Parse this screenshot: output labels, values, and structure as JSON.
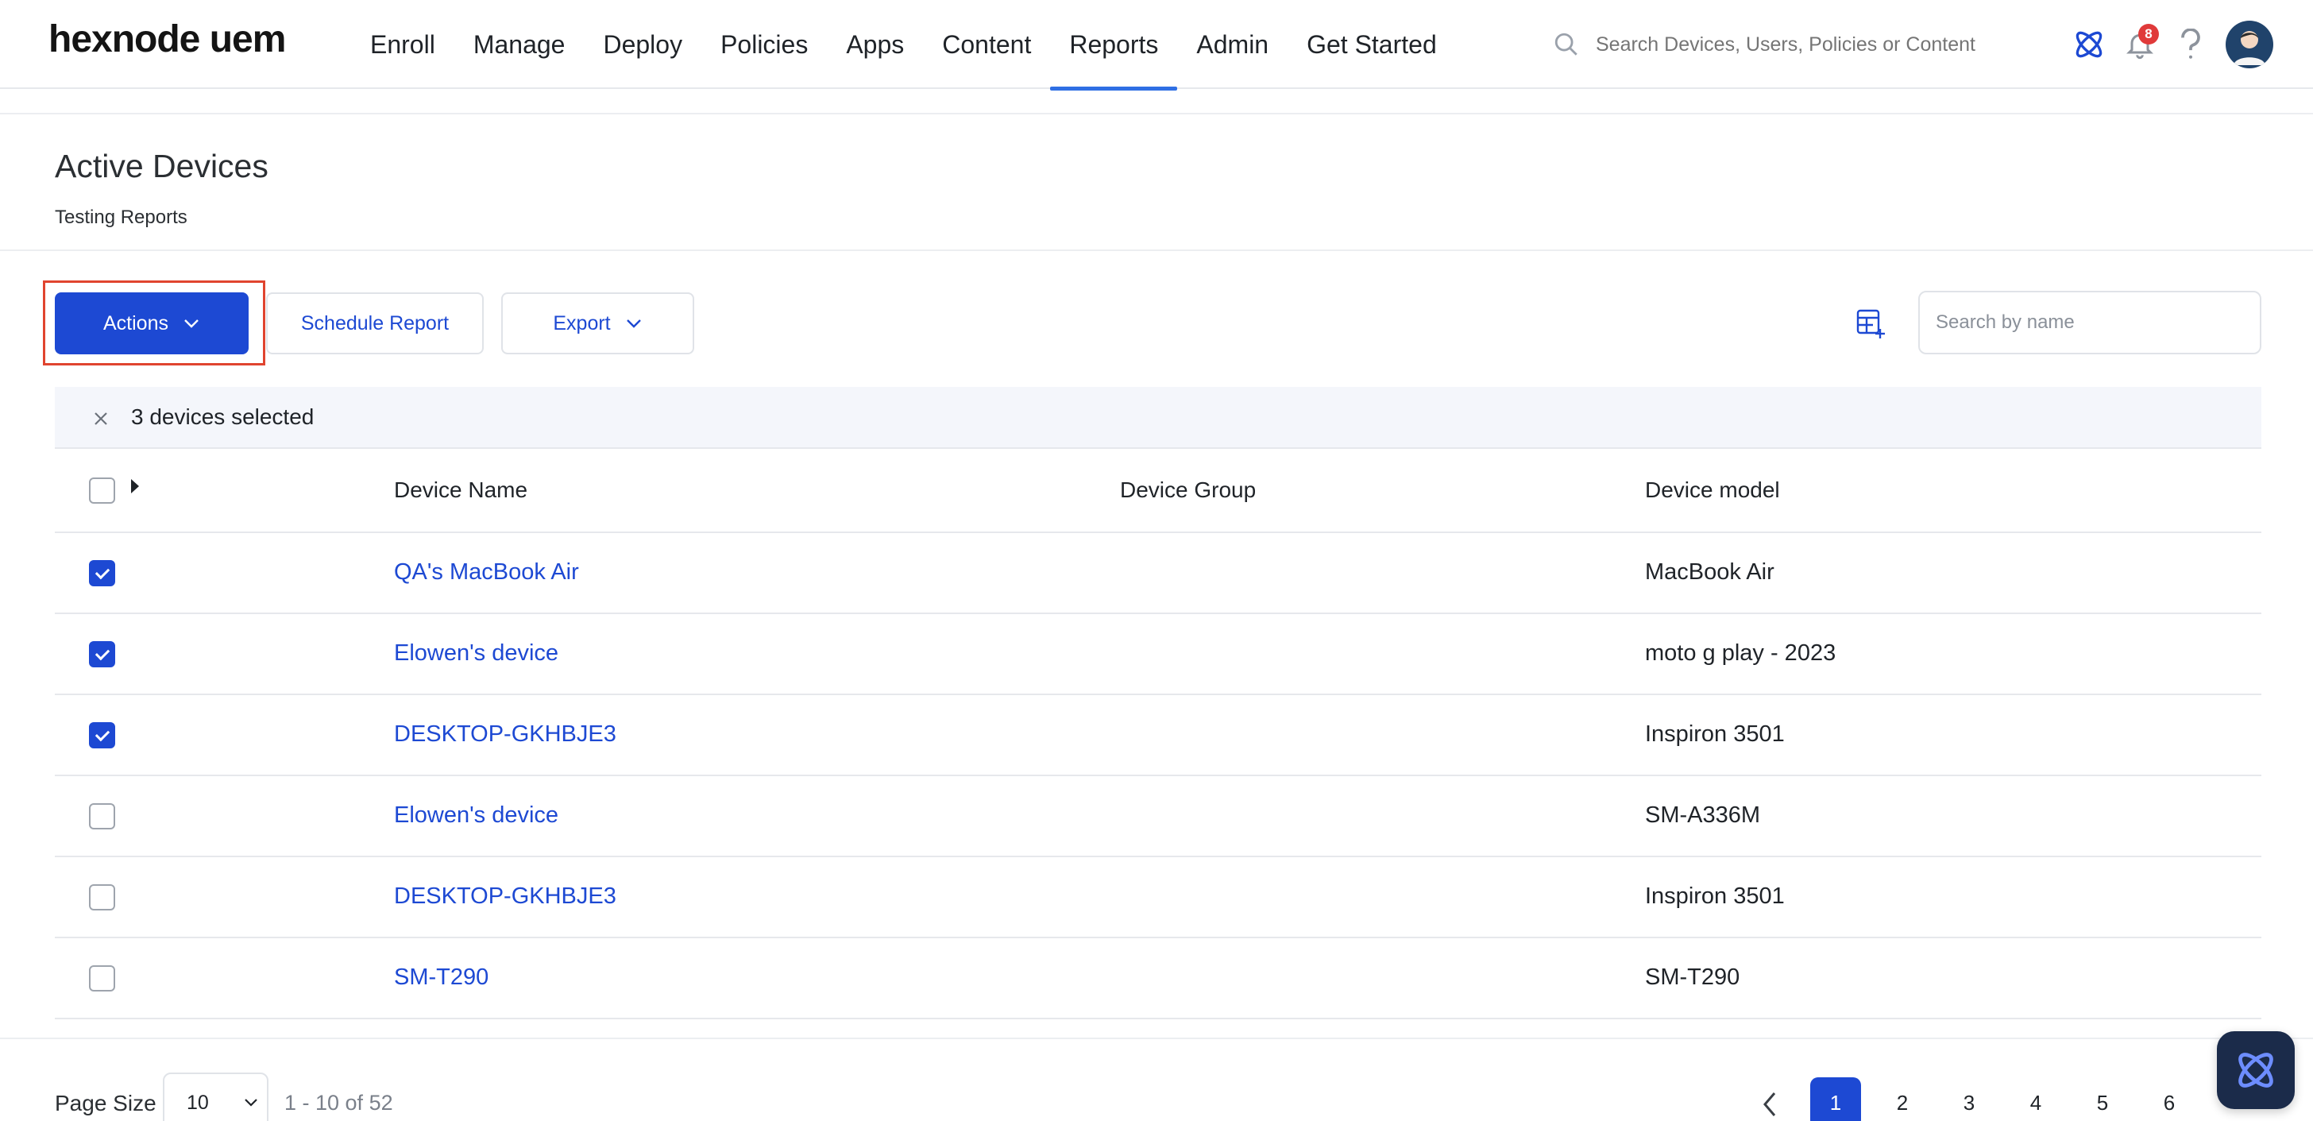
{
  "app": {
    "logo_text": "hexnode uem"
  },
  "nav": {
    "items": [
      {
        "label": "Enroll",
        "active": false
      },
      {
        "label": "Manage",
        "active": false
      },
      {
        "label": "Deploy",
        "active": false
      },
      {
        "label": "Policies",
        "active": false
      },
      {
        "label": "Apps",
        "active": false
      },
      {
        "label": "Content",
        "active": false
      },
      {
        "label": "Reports",
        "active": true
      },
      {
        "label": "Admin",
        "active": false
      },
      {
        "label": "Get Started",
        "active": false
      }
    ],
    "search_placeholder": "Search Devices, Users, Policies or Content",
    "notification_count": "8",
    "icons": [
      "atom-logo-icon",
      "bell-icon",
      "help-icon",
      "avatar"
    ]
  },
  "page": {
    "title": "Active Devices",
    "subtitle": "Testing Reports"
  },
  "toolbar": {
    "actions_label": "Actions",
    "schedule_label": "Schedule Report",
    "export_label": "Export",
    "search_placeholder": "Search by name"
  },
  "selection": {
    "text": "3 devices selected"
  },
  "table": {
    "columns": [
      "Device Name",
      "Device Group",
      "Device model"
    ],
    "rows": [
      {
        "name": "QA's MacBook Air",
        "group": "",
        "model": "MacBook Air",
        "checked": true
      },
      {
        "name": "Elowen's device",
        "group": "",
        "model": "moto g play - 2023",
        "checked": true
      },
      {
        "name": "DESKTOP-GKHBJE3",
        "group": "",
        "model": "Inspiron 3501",
        "checked": true
      },
      {
        "name": "Elowen's device",
        "group": "",
        "model": "SM-A336M",
        "checked": false
      },
      {
        "name": "DESKTOP-GKHBJE3",
        "group": "",
        "model": "Inspiron 3501",
        "checked": false
      },
      {
        "name": "SM-T290",
        "group": "",
        "model": "SM-T290",
        "checked": false
      }
    ]
  },
  "pagination": {
    "page_size_label": "Page Size",
    "page_size": "10",
    "range_text": "1 - 10 of 52",
    "pages": [
      "1",
      "2",
      "3",
      "4",
      "5",
      "6"
    ],
    "current_page": "1"
  },
  "colors": {
    "primary": "#1d49d3",
    "highlight_border": "#e0442f",
    "nav_active_underline": "#2f6fe4",
    "badge": "#e03a3a"
  }
}
